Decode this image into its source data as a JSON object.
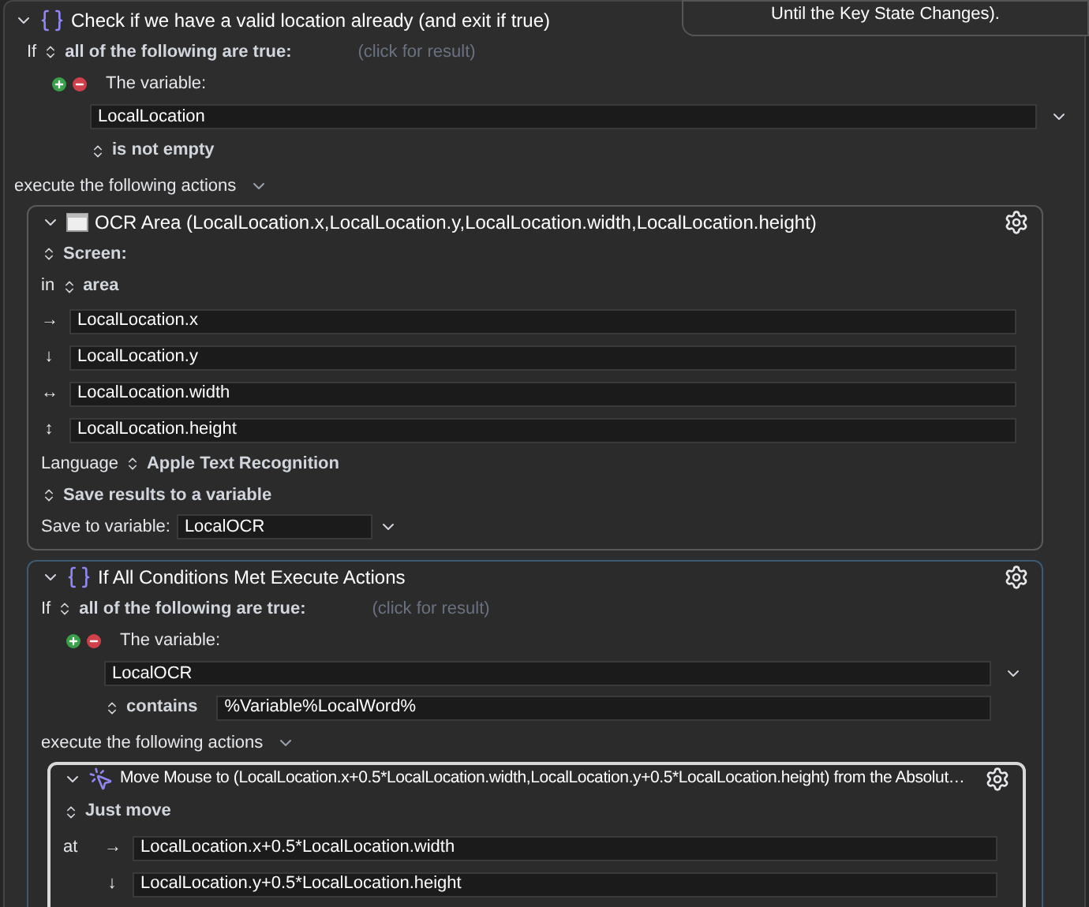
{
  "tooltip": {
    "text": "Until the Key State Changes)."
  },
  "outer": {
    "title": "Check if we have a valid location already (and exit if true)",
    "expanded": true,
    "condition": {
      "prefix": "If",
      "mode": "all of the following are true:",
      "hint": "(click for result)",
      "label": "The variable:",
      "variable": "LocalLocation",
      "operator": "is not empty"
    },
    "execute": "execute the following actions",
    "ocr": {
      "title": "OCR Area (LocalLocation.x,LocalLocation.y,LocalLocation.width,LocalLocation.height)",
      "expanded": true,
      "screen": "Screen:",
      "in": "in",
      "area": "area",
      "coords": [
        {
          "glyph": "→",
          "value": "LocalLocation.x"
        },
        {
          "glyph": "↓",
          "value": "LocalLocation.y"
        },
        {
          "glyph": "↔",
          "value": "LocalLocation.width"
        },
        {
          "glyph": "↕",
          "value": "LocalLocation.height"
        }
      ],
      "language_label": "Language",
      "language": "Apple Text Recognition",
      "save_mode": "Save results to a variable",
      "save_label": "Save to variable:",
      "save_var": "LocalOCR"
    },
    "inner": {
      "title": "If All Conditions Met Execute Actions",
      "expanded": true,
      "condition": {
        "prefix": "If",
        "mode": "all of the following are true:",
        "hint": "(click for result)",
        "label": "The variable:",
        "variable": "LocalOCR",
        "operator": "contains",
        "operand": "%Variable%LocalWord%"
      },
      "execute": "execute the following actions",
      "move": {
        "title": "Move Mouse to (LocalLocation.x+0.5*LocalLocation.width,LocalLocation.y+0.5*LocalLocation.height) from the Absolut…",
        "expanded": true,
        "mode": "Just move",
        "at": "at",
        "coords": [
          {
            "glyph": "→",
            "value": "LocalLocation.x+0.5*LocalLocation.width"
          },
          {
            "glyph": "↓",
            "value": "LocalLocation.y+0.5*LocalLocation.height"
          }
        ]
      }
    }
  }
}
